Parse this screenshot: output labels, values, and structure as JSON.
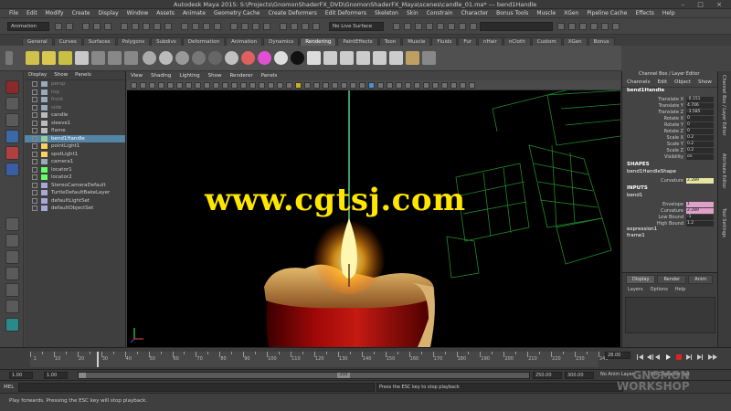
{
  "app": {
    "title": "Autodesk Maya 2015: S:\\Projects\\GnomonShaderFX_DVD\\GnomonShaderFX_Maya\\scenes\\candle_01.ma* --- bend1Handle",
    "window_controls": [
      "–",
      "□",
      "×"
    ]
  },
  "menubar": [
    "File",
    "Edit",
    "Modify",
    "Create",
    "Display",
    "Window",
    "Assets",
    "Animate",
    "Geometry Cache",
    "Create Deformers",
    "Edit Deformers",
    "Skeleton",
    "Skin",
    "Constrain",
    "Character",
    "Bonus Tools",
    "Muscle",
    "XGen",
    "Pipeline Cache",
    "Effects",
    "Help"
  ],
  "statusline": {
    "mode_combo": "Animation",
    "live_surface": "No Live Surface"
  },
  "shelf_tabs": [
    "General",
    "Curves",
    "Surfaces",
    "Polygons",
    "Subdivs",
    "Deformation",
    "Animation",
    "Dynamics",
    "Rendering",
    "PaintEffects",
    "Toon",
    "Muscle",
    "Fluids",
    "Fur",
    "nHair",
    "nCloth",
    "Custom",
    "XGen",
    "Bonus"
  ],
  "shelf_active_tab": "Rendering",
  "outliner": {
    "menu": [
      "Display",
      "Show",
      "Panels"
    ],
    "items": [
      {
        "label": "persp",
        "type": "camera",
        "faded": true
      },
      {
        "label": "top",
        "type": "camera",
        "faded": true
      },
      {
        "label": "front",
        "type": "camera",
        "faded": true
      },
      {
        "label": "side",
        "type": "camera",
        "faded": true
      },
      {
        "label": "candle",
        "type": "mesh",
        "faded": false
      },
      {
        "label": "sleeve1",
        "type": "mesh",
        "faded": false
      },
      {
        "label": "flame",
        "type": "mesh",
        "faded": false
      },
      {
        "label": "bend1Handle",
        "type": "deformer",
        "faded": false,
        "selected": true
      },
      {
        "label": "pointLight1",
        "type": "light",
        "faded": false
      },
      {
        "label": "spotLight1",
        "type": "light",
        "faded": false
      },
      {
        "label": "camera1",
        "type": "camera",
        "faded": false
      },
      {
        "label": "locator1",
        "type": "locator",
        "faded": false
      },
      {
        "label": "locator2",
        "type": "locator",
        "faded": false
      },
      {
        "label": "StereoCameraDefault",
        "type": "set",
        "faded": false
      },
      {
        "label": "TurtleDefaultBakeLayer",
        "type": "layer",
        "faded": false
      },
      {
        "label": "defaultLightSet",
        "type": "set",
        "faded": false
      },
      {
        "label": "defaultObjectSet",
        "type": "set",
        "faded": false
      }
    ]
  },
  "viewport": {
    "menu": [
      "View",
      "Shading",
      "Lighting",
      "Show",
      "Renderer",
      "Panels"
    ],
    "watermark": "www.cgtsj.com"
  },
  "channel_box": {
    "header": "Channel Box / Layer Editor",
    "menu": [
      "Channels",
      "Edit",
      "Object",
      "Show"
    ],
    "node": "bend1Handle",
    "attributes": [
      {
        "label": "Translate X",
        "value": "-0.151"
      },
      {
        "label": "Translate Y",
        "value": "4.706"
      },
      {
        "label": "Translate Z",
        "value": "-3.585"
      },
      {
        "label": "Rotate X",
        "value": "0"
      },
      {
        "label": "Rotate Y",
        "value": "0"
      },
      {
        "label": "Rotate Z",
        "value": "0"
      },
      {
        "label": "Scale X",
        "value": "0.2"
      },
      {
        "label": "Scale Y",
        "value": "0.2"
      },
      {
        "label": "Scale Z",
        "value": "0.2"
      },
      {
        "label": "Visibility",
        "value": "on"
      }
    ],
    "shapes_header": "SHAPES",
    "shape_node": "bend1HandleShape",
    "shape_attrs": [
      {
        "label": "Curvature",
        "value": "2.289",
        "highlight": "y"
      }
    ],
    "inputs_header": "INPUTS",
    "input_node": "bend1",
    "input_attrs": [
      {
        "label": "Envelope",
        "value": "1",
        "highlight": "p"
      },
      {
        "label": "Curvature",
        "value": "2.289",
        "highlight": "p"
      },
      {
        "label": "Low Bound",
        "value": "-1",
        "highlight": ""
      },
      {
        "label": "High Bound",
        "value": "1.2",
        "highlight": ""
      }
    ],
    "extra_nodes": [
      "expression1",
      "frame1"
    ]
  },
  "layer_editor": {
    "tabs": [
      "Display",
      "Render",
      "Anim"
    ],
    "menu": [
      "Layers",
      "Options",
      "Help"
    ]
  },
  "right_strip_tabs": [
    "Channel Box / Layer Editor",
    "Attribute Editor",
    "Tool Settings"
  ],
  "timeline": {
    "tick_labels": [
      "1",
      "10",
      "20",
      "30",
      "40",
      "50",
      "60",
      "70",
      "80",
      "90",
      "100",
      "110",
      "120",
      "130",
      "140",
      "150",
      "160",
      "170",
      "180",
      "190",
      "200",
      "210",
      "220",
      "230",
      "240"
    ],
    "current_frame": "28.00"
  },
  "range": {
    "start": "1.00",
    "start_inner": "1.00",
    "slider_end": "250",
    "end_inner": "250.00",
    "end": "300.00",
    "anim_layer": "No Anim Layer",
    "char_set": "No Character Set"
  },
  "cmdline": {
    "mel": "MEL",
    "status": "Press the ESC key to stop playback"
  },
  "help_line": "Play forwards. Pressing the ESC key will stop playback.",
  "brand": {
    "line1": "GNOMON",
    "line2": "WORKSHOP"
  }
}
